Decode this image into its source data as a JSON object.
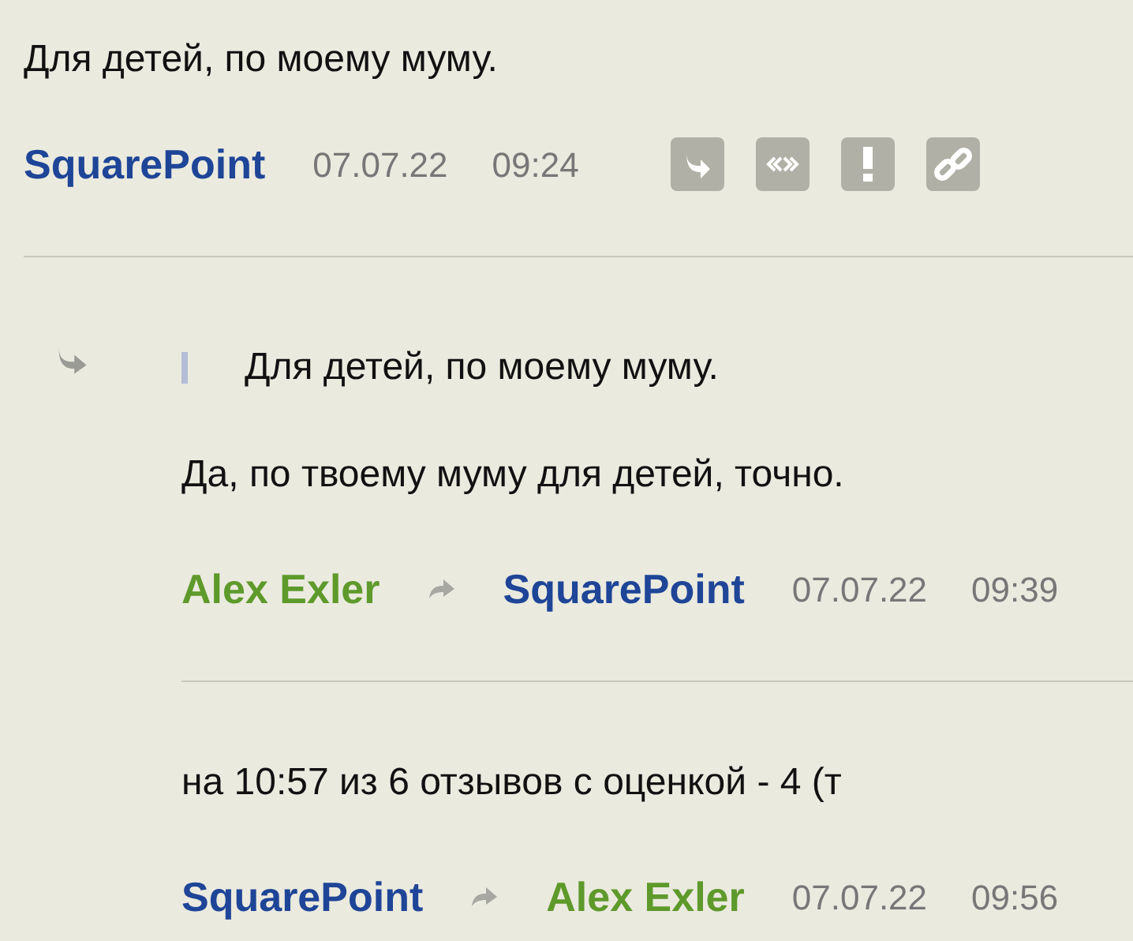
{
  "comment": {
    "text": "Для детей, по моему муму.",
    "author": {
      "name": "SquarePoint",
      "color": "#1e4597"
    },
    "date": "07.07.22",
    "time": "09:24"
  },
  "replies": [
    {
      "quote": "Для детей, по моему муму.",
      "text": "Да, по твоему муму для детей, точно.",
      "author": {
        "name": "Alex Exler",
        "color": "#5e9a2b"
      },
      "reply_to": {
        "name": "SquarePoint",
        "color": "#1e4597"
      },
      "date": "07.07.22",
      "time": "09:39"
    },
    {
      "text": "на 10:57 из 6 отзывов с оценкой - 4 (т",
      "author": {
        "name": "SquarePoint",
        "color": "#1e4597"
      },
      "reply_to": {
        "name": "Alex Exler",
        "color": "#5e9a2b"
      },
      "date": "07.07.22",
      "time": "09:56"
    }
  ]
}
